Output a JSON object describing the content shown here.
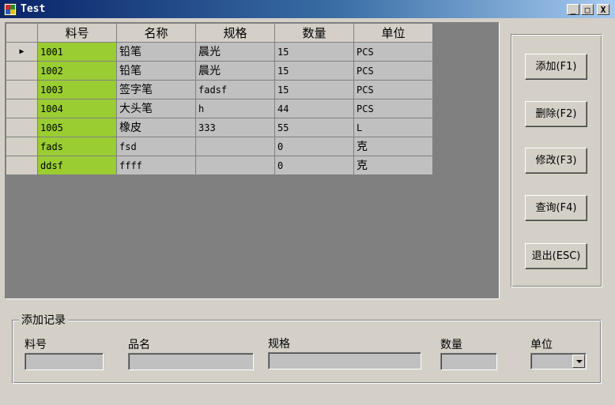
{
  "window": {
    "title": "Test",
    "minimize": "_",
    "maximize": "□",
    "close": "X"
  },
  "grid": {
    "columns": [
      "料号",
      "名称",
      "规格",
      "数量",
      "单位"
    ],
    "current_row_indicator": "▶",
    "rows": [
      [
        "1001",
        "铅笔",
        "晨光",
        "15",
        "PCS"
      ],
      [
        "1002",
        "铅笔",
        "晨光",
        "15",
        "PCS"
      ],
      [
        "1003",
        "签字笔",
        "fadsf",
        "15",
        "PCS"
      ],
      [
        "1004",
        "大头笔",
        "h",
        "44",
        "PCS"
      ],
      [
        "1005",
        "橡皮",
        "333",
        "55",
        "L"
      ],
      [
        "fads",
        "fsd",
        "",
        "0",
        "克"
      ],
      [
        "ddsf",
        "ffff",
        "",
        "0",
        "克"
      ]
    ],
    "code_column_color": "#9acd32"
  },
  "buttons": {
    "add": "添加(F1)",
    "delete": "删除(F2)",
    "edit": "修改(F3)",
    "query": "查询(F4)",
    "exit": "退出(ESC)"
  },
  "add_record": {
    "legend": "添加记录",
    "labels": {
      "code": "料号",
      "name": "品名",
      "spec": "规格",
      "qty": "数量",
      "unit": "单位"
    },
    "values": {
      "code": "",
      "name": "",
      "spec": "",
      "qty": "",
      "unit": ""
    }
  }
}
